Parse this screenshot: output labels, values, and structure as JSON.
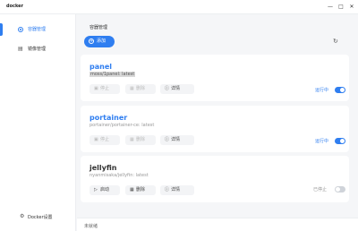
{
  "window": {
    "title": "docker",
    "minimize_icon": "minimize-icon",
    "maximize_icon": "maximize-icon",
    "close_icon": "close-icon"
  },
  "sidebar": {
    "items": [
      {
        "label": "容器管理",
        "icon": "radio-icon",
        "active": true
      },
      {
        "label": "镜像管理",
        "icon": "layers-icon",
        "active": false
      }
    ],
    "footer": {
      "label": "Docker设置",
      "icon": "settings-icon"
    }
  },
  "main": {
    "title": "容器管理",
    "add_label": "添加",
    "refresh_icon": "refresh-icon"
  },
  "containers": [
    {
      "name": "panel",
      "image": "moss/1panel: latest",
      "status": "运行中",
      "running": true,
      "stop_label": "停止",
      "delete_label": "删除",
      "detail_label": "详情"
    },
    {
      "name": "portainer",
      "image": "portainer/portainer-ce: latest",
      "status": "运行中",
      "running": true,
      "stop_label": "停止",
      "delete_label": "删除",
      "detail_label": "详情"
    },
    {
      "name": "jellyfin",
      "image": "nyanmisaka/jellyfin: latest",
      "status": "已停止",
      "running": false,
      "stop_label": "启动",
      "delete_label": "删除",
      "detail_label": "详情"
    }
  ],
  "status_bar": {
    "text": "未就绪"
  },
  "colors": {
    "accent": "#2f7ef0",
    "sidebar_bg": "#ffffff",
    "page_bg": "#f5f6f8"
  }
}
